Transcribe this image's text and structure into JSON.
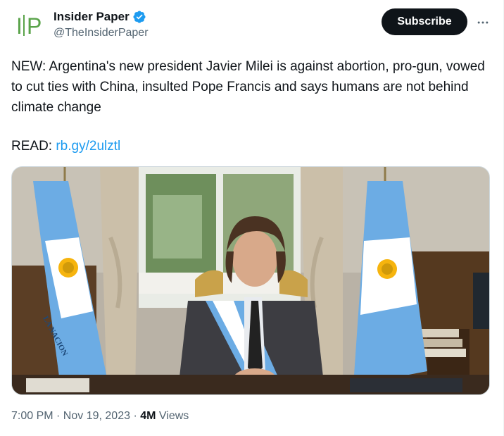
{
  "author": {
    "display_name": "Insider Paper",
    "handle": "@TheInsiderPaper",
    "avatar_text": "IP",
    "verified": true,
    "verified_color": "#1d9bf0"
  },
  "actions": {
    "subscribe_label": "Subscribe",
    "more_icon": "more-horizontal-icon"
  },
  "tweet": {
    "text": "NEW: Argentina's new president Javier Milei is against abortion, pro-gun, vowed to cut ties with China, insulted Pope Francis and says humans are not behind climate change",
    "read_label": "READ:",
    "link_text": "rb.gy/2ulztl"
  },
  "media": {
    "sash_text": "LA NACION"
  },
  "meta": {
    "timestamp": "7:00 PM · Nov 19, 2023",
    "separator": "·",
    "views_count": "4M",
    "views_label": "Views"
  },
  "colors": {
    "accent": "#1d9bf0",
    "text": "#0f1419",
    "secondary": "#536471",
    "flag_blue": "#6cace4",
    "flag_sun": "#f6b40e"
  }
}
